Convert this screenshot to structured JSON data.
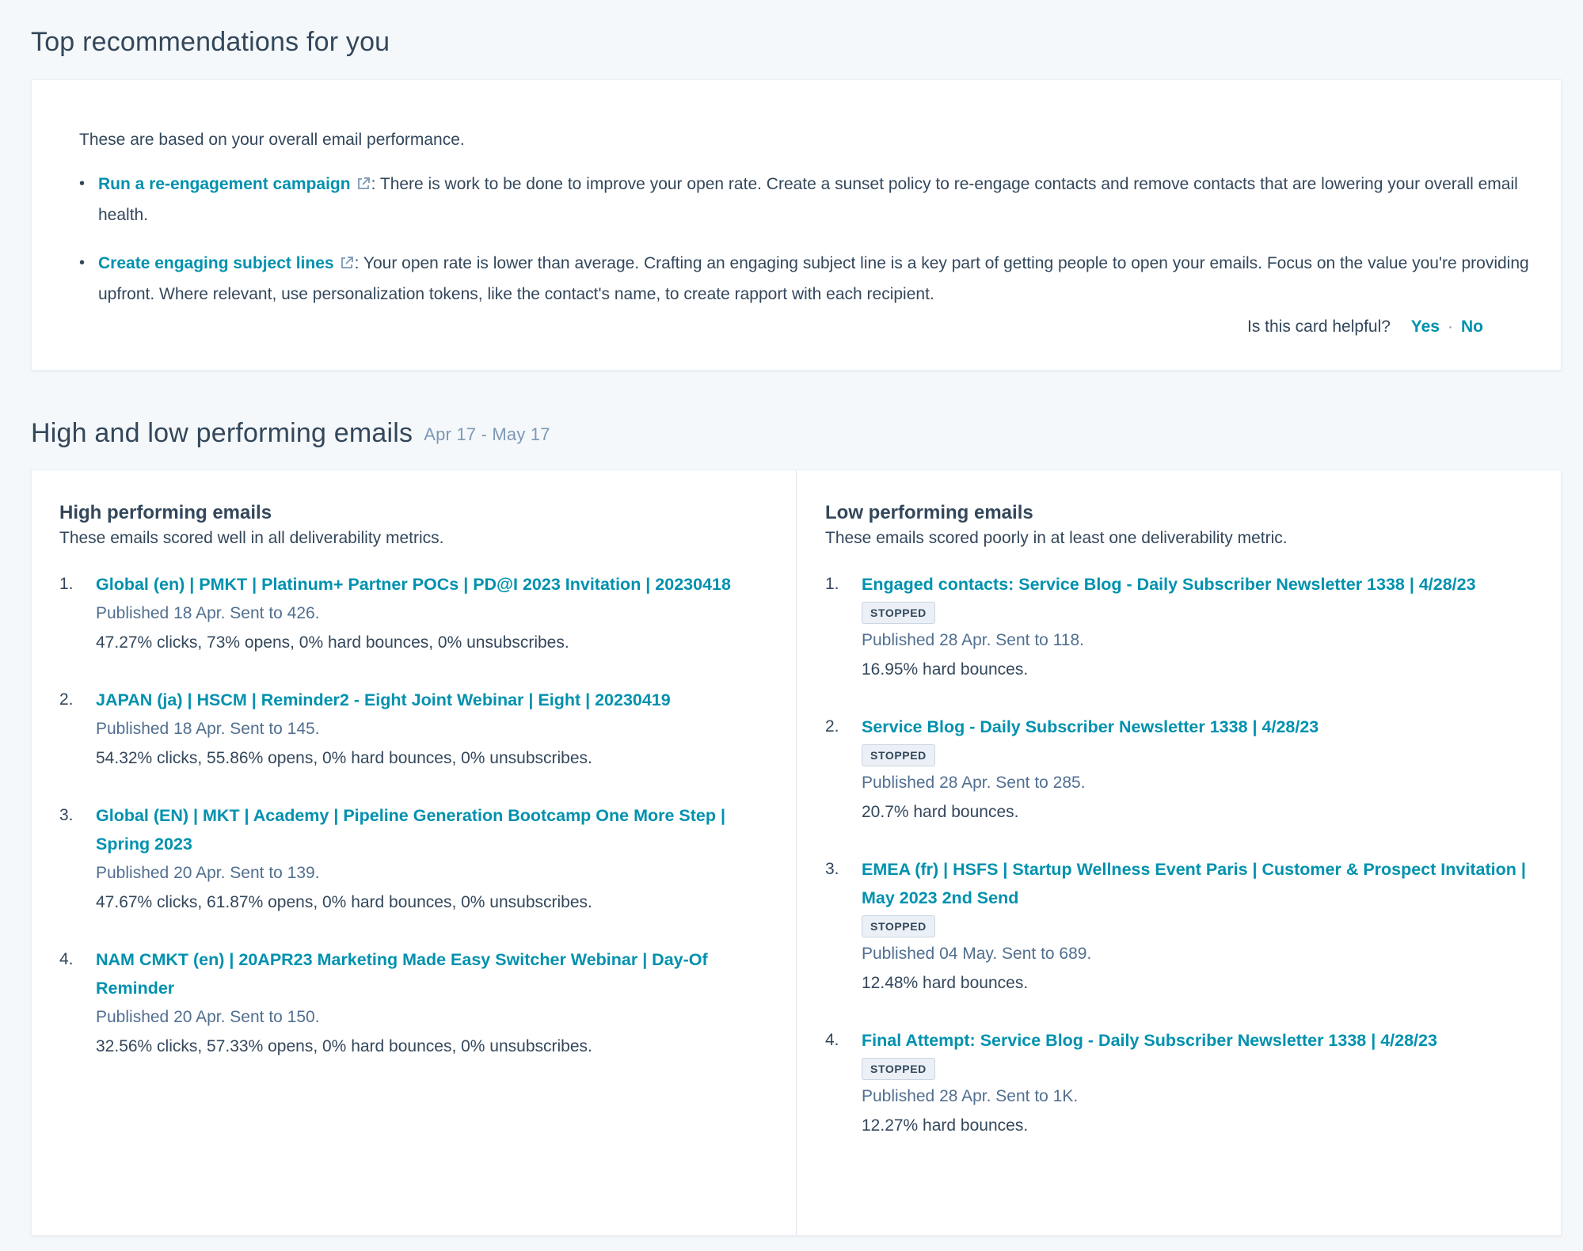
{
  "recommendations": {
    "title": "Top recommendations for you",
    "intro": "These are based on your overall email performance.",
    "items": [
      {
        "link": "Run a re-engagement campaign",
        "text": ": There is work to be done to improve your open rate. Create a sunset policy to re-engage contacts and remove contacts that are lowering your overall email health."
      },
      {
        "link": "Create engaging subject lines",
        "text": ": Your open rate is lower than average. Crafting an engaging subject line is a key part of getting people to open your emails. Focus on the value you're providing upfront. Where relevant, use personalization tokens, like the contact's name, to create rapport with each recipient."
      }
    ],
    "helpful": {
      "question": "Is this card helpful?",
      "yes": "Yes",
      "separator": "·",
      "no": "No"
    }
  },
  "performance": {
    "title": "High and low performing emails",
    "date_range": "Apr 17 - May 17",
    "high": {
      "title": "High performing emails",
      "description": "These emails scored well in all deliverability metrics.",
      "emails": [
        {
          "num": "1.",
          "name": "Global (en) | PMKT | Platinum+ Partner POCs | PD@I 2023 Invitation | 20230418",
          "published": "Published 18 Apr. Sent to 426.",
          "stats": "47.27% clicks, 73% opens, 0% hard bounces, 0% unsubscribes."
        },
        {
          "num": "2.",
          "name": "JAPAN (ja) | HSCM | Reminder2 - Eight Joint Webinar | Eight | 20230419",
          "published": "Published 18 Apr. Sent to 145.",
          "stats": "54.32% clicks, 55.86% opens, 0% hard bounces, 0% unsubscribes."
        },
        {
          "num": "3.",
          "name": "Global (EN) | MKT | Academy | Pipeline Generation Bootcamp One More Step | Spring 2023",
          "published": "Published 20 Apr. Sent to 139.",
          "stats": "47.67% clicks, 61.87% opens, 0% hard bounces, 0% unsubscribes."
        },
        {
          "num": "4.",
          "name": "NAM CMKT (en) | 20APR23 Marketing Made Easy Switcher Webinar | Day-Of Reminder",
          "published": "Published 20 Apr. Sent to 150.",
          "stats": "32.56% clicks, 57.33% opens, 0% hard bounces, 0% unsubscribes."
        }
      ]
    },
    "low": {
      "title": "Low performing emails",
      "description": "These emails scored poorly in at least one deliverability metric.",
      "emails": [
        {
          "num": "1.",
          "name": "Engaged contacts: Service Blog - Daily Subscriber Newsletter 1338 | 4/28/23",
          "badge": "STOPPED",
          "published": "Published 28 Apr. Sent to 118.",
          "stats": "16.95% hard bounces."
        },
        {
          "num": "2.",
          "name": "Service Blog - Daily Subscriber Newsletter 1338 | 4/28/23",
          "badge": "STOPPED",
          "published": "Published 28 Apr. Sent to 285.",
          "stats": "20.7% hard bounces."
        },
        {
          "num": "3.",
          "name": "EMEA (fr) | HSFS | Startup Wellness Event Paris | Customer & Prospect Invitation | May 2023 2nd Send",
          "badge": "STOPPED",
          "published": "Published 04 May. Sent to 689.",
          "stats": "12.48% hard bounces."
        },
        {
          "num": "4.",
          "name": "Final Attempt: Service Blog - Daily Subscriber Newsletter 1338 | 4/28/23",
          "badge": "STOPPED",
          "published": "Published 28 Apr. Sent to 1K.",
          "stats": "12.27% hard bounces."
        }
      ]
    }
  },
  "colors": {
    "link": "#0091ae",
    "text": "#33475b",
    "muted": "#516f90",
    "background": "#f5f8fa"
  },
  "icons": {
    "external_link": "external-link-icon"
  }
}
